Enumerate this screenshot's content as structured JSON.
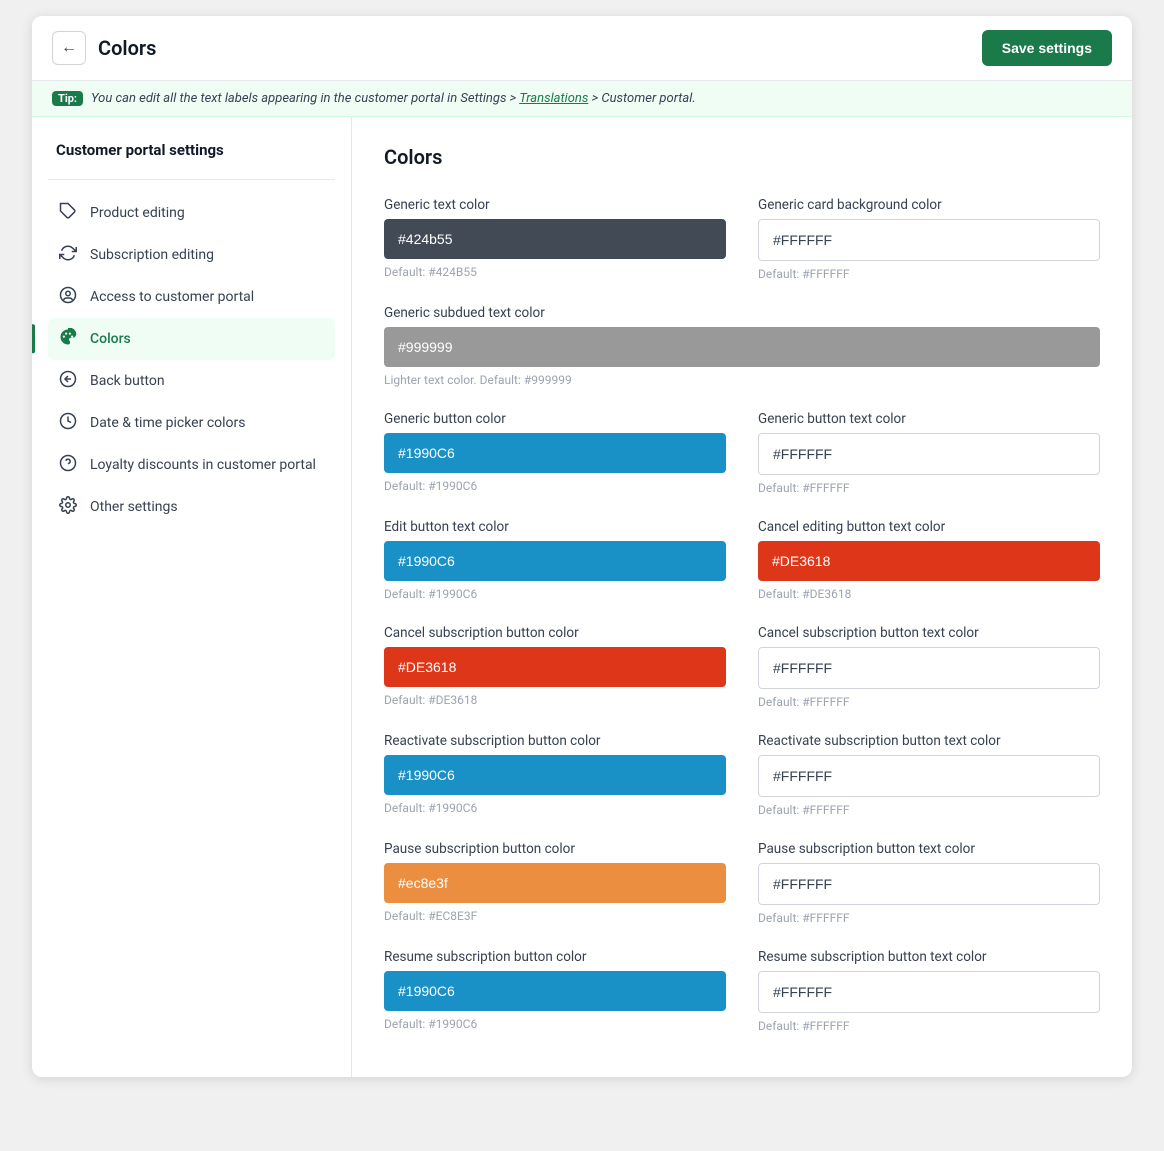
{
  "header": {
    "title": "Colors",
    "save_label": "Save settings",
    "back_icon": "←"
  },
  "tip": {
    "badge": "Tip:",
    "text": " You can edit all the text labels appearing in the customer portal in Settings > ",
    "link": "Translations",
    "text2": " > Customer portal."
  },
  "sidebar": {
    "title": "Customer portal settings",
    "items": [
      {
        "id": "product-editing",
        "label": "Product editing",
        "icon": "tag",
        "active": false
      },
      {
        "id": "subscription-editing",
        "label": "Subscription editing",
        "icon": "refresh",
        "active": false
      },
      {
        "id": "access-customer-portal",
        "label": "Access to customer portal",
        "icon": "user-circle",
        "active": false
      },
      {
        "id": "colors",
        "label": "Colors",
        "icon": "palette",
        "active": true
      },
      {
        "id": "back-button",
        "label": "Back button",
        "icon": "arrow-circle",
        "active": false
      },
      {
        "id": "date-time-picker",
        "label": "Date & time picker colors",
        "icon": "clock-circle",
        "active": false
      },
      {
        "id": "loyalty-discounts",
        "label": "Loyalty discounts in customer portal",
        "icon": "tag-circle",
        "active": false
      },
      {
        "id": "other-settings",
        "label": "Other settings",
        "icon": "gear",
        "active": false
      }
    ]
  },
  "content": {
    "title": "Colors",
    "color_fields": [
      {
        "id": "generic-text-color",
        "label": "Generic text color",
        "value": "#424b55",
        "default": "Default: #424B55",
        "bg": "#424b55",
        "is_white": false,
        "col": 1
      },
      {
        "id": "generic-card-bg-color",
        "label": "Generic card background color",
        "value": "#FFFFFF",
        "default": "Default: #FFFFFF",
        "bg": "#FFFFFF",
        "is_white": true,
        "col": 2
      },
      {
        "id": "generic-subdued-text-color",
        "label": "Generic subdued text color",
        "value": "#999999",
        "default": "Lighter text color. Default: #999999",
        "bg": "#999999",
        "is_white": false,
        "col": 1,
        "span": 2
      },
      {
        "id": "generic-button-color",
        "label": "Generic button color",
        "value": "#1990C6",
        "default": "Default: #1990C6",
        "bg": "#1990C6",
        "is_white": false,
        "col": 1
      },
      {
        "id": "generic-button-text-color",
        "label": "Generic button text color",
        "value": "#FFFFFF",
        "default": "Default: #FFFFFF",
        "bg": "#FFFFFF",
        "is_white": true,
        "col": 2
      },
      {
        "id": "edit-button-text-color",
        "label": "Edit button text color",
        "value": "#1990C6",
        "default": "Default: #1990C6",
        "bg": "#1990C6",
        "is_white": false,
        "col": 1
      },
      {
        "id": "cancel-editing-button-text-color",
        "label": "Cancel editing button text color",
        "value": "#DE3618",
        "default": "Default: #DE3618",
        "bg": "#DE3618",
        "is_white": false,
        "col": 2
      },
      {
        "id": "cancel-subscription-button-color",
        "label": "Cancel subscription button color",
        "value": "#DE3618",
        "default": "Default: #DE3618",
        "bg": "#DE3618",
        "is_white": false,
        "col": 1
      },
      {
        "id": "cancel-subscription-button-text-color",
        "label": "Cancel subscription button text color",
        "value": "#FFFFFF",
        "default": "Default: #FFFFFF",
        "bg": "#FFFFFF",
        "is_white": true,
        "col": 2
      },
      {
        "id": "reactivate-subscription-button-color",
        "label": "Reactivate subscription button color",
        "value": "#1990C6",
        "default": "Default: #1990C6",
        "bg": "#1990C6",
        "is_white": false,
        "col": 1
      },
      {
        "id": "reactivate-subscription-button-text-color",
        "label": "Reactivate subscription button text color",
        "value": "#FFFFFF",
        "default": "Default: #FFFFFF",
        "bg": "#FFFFFF",
        "is_white": true,
        "col": 2
      },
      {
        "id": "pause-subscription-button-color",
        "label": "Pause subscription button color",
        "value": "#ec8e3f",
        "default": "Default: #EC8E3F",
        "bg": "#ec8e3f",
        "is_white": false,
        "col": 1
      },
      {
        "id": "pause-subscription-button-text-color",
        "label": "Pause subscription button text color",
        "value": "#FFFFFF",
        "default": "Default: #FFFFFF",
        "bg": "#FFFFFF",
        "is_white": true,
        "col": 2
      },
      {
        "id": "resume-subscription-button-color",
        "label": "Resume subscription button color",
        "value": "#1990C6",
        "default": "Default: #1990C6",
        "bg": "#1990C6",
        "is_white": false,
        "col": 1
      },
      {
        "id": "resume-subscription-button-text-color",
        "label": "Resume subscription button text color",
        "value": "#FFFFFF",
        "default": "Default: #FFFFFF",
        "bg": "#FFFFFF",
        "is_white": true,
        "col": 2
      }
    ]
  }
}
